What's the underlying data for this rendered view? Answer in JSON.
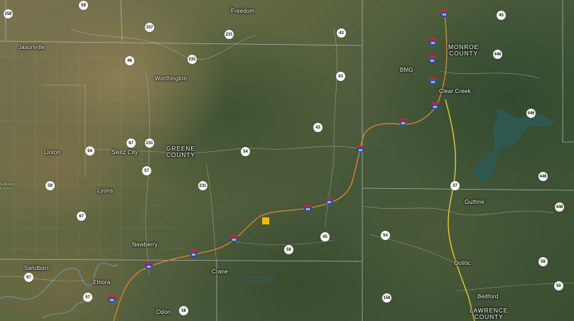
{
  "map": {
    "type": "satellite",
    "counties": [
      {
        "id": "greene",
        "line1": "GREENE",
        "line2": "COUNTY"
      },
      {
        "id": "monroe",
        "line1": "MONROE",
        "line2": "COUNTY"
      },
      {
        "id": "lawrence",
        "line1": "LAWRENCE",
        "line2": "COUNTY"
      }
    ],
    "places": {
      "freedom": "Freedom",
      "jasonville": "Jasonville",
      "worthington": "Worthington",
      "linton": "Linton",
      "switz_city": "Switz City",
      "lyons": "Lyons",
      "newberry": "Newberry",
      "sandborn": "Sandborn",
      "elnora": "Elnora",
      "odon": "Odon",
      "crane": "Crane",
      "clear_creek": "Clear Creek",
      "bmg": "BMG",
      "guthrie": "Guthrie",
      "oolitic": "Oolitic",
      "bedford": "Bedford"
    },
    "forest_label": {
      "line1": "Sullivan",
      "line2": "Forest"
    },
    "routes": {
      "r59a": "59",
      "r157": "157",
      "r231a": "231",
      "r43a": "43",
      "r45": "45",
      "r159": "159",
      "r48": "48",
      "r231b": "231",
      "r43b": "43",
      "r43c": "43",
      "r446a": "446",
      "r67": "67",
      "r231c": "231",
      "r54a": "54",
      "r54b": "54",
      "r446b": "446",
      "r57": "57",
      "r59b": "59",
      "r231d": "231",
      "r37": "37",
      "r446c": "446",
      "r67b": "67",
      "r446d": "446",
      "r45b": "45",
      "r54c": "54",
      "r58a": "58",
      "r58b": "58",
      "r58c": "58",
      "r57b": "57",
      "r67c": "67",
      "r158": "158",
      "r50": "50"
    },
    "interstate": "69",
    "marker": {
      "color": "#f6b800"
    }
  }
}
